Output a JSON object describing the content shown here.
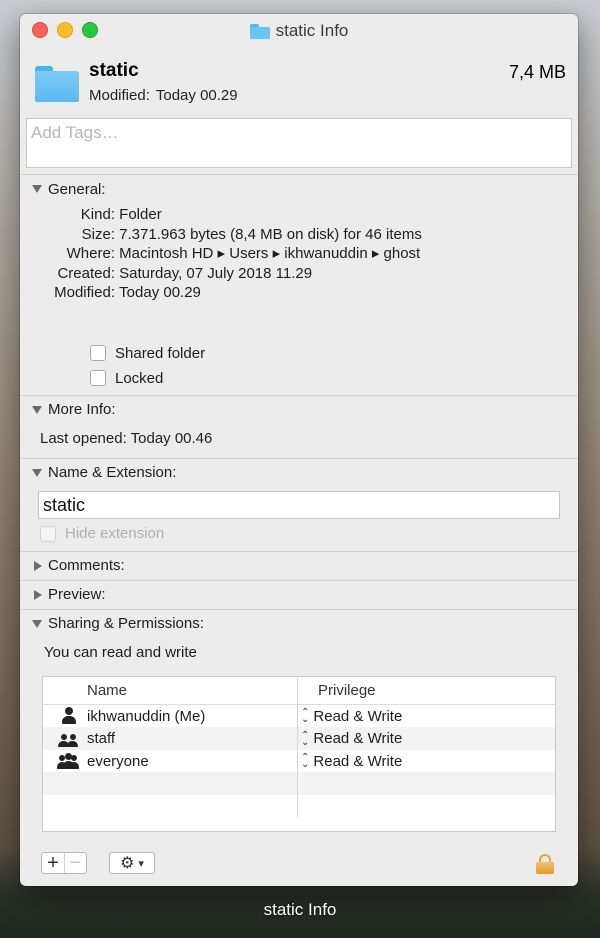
{
  "window": {
    "title": "static Info"
  },
  "header": {
    "name": "static",
    "modified_label": "Modified:",
    "modified_value": "Today 00.29",
    "size": "7,4 MB"
  },
  "tags": {
    "placeholder": "Add Tags…"
  },
  "general": {
    "heading": "General:",
    "rows": [
      {
        "k": "Kind:",
        "v": "Folder"
      },
      {
        "k": "Size:",
        "v": "7.371.963 bytes (8,4 MB on disk) for 46 items"
      },
      {
        "k": "Where:",
        "v": "Macintosh HD ▸ Users ▸ ikhwanuddin ▸ ghost"
      },
      {
        "k": "Created:",
        "v": "Saturday, 07 July 2018 11.29"
      },
      {
        "k": "Modified:",
        "v": "Today 00.29"
      }
    ],
    "shared_folder": "Shared folder",
    "locked": "Locked"
  },
  "more_info": {
    "heading": "More Info:",
    "last_opened": "Last opened: Today 00.46"
  },
  "name_ext": {
    "heading": "Name & Extension:",
    "name_value": "static",
    "hide_extension": "Hide extension"
  },
  "comments": {
    "heading": "Comments:"
  },
  "preview": {
    "heading": "Preview:"
  },
  "sharing": {
    "heading": "Sharing & Permissions:",
    "note": "You can read and write",
    "col_name": "Name",
    "col_privilege": "Privilege",
    "rows": [
      {
        "name": "ikhwanuddin (Me)",
        "privilege": "Read & Write"
      },
      {
        "name": "staff",
        "privilege": "Read & Write"
      },
      {
        "name": "everyone",
        "privilege": "Read & Write"
      }
    ]
  },
  "toolbar": {
    "plus": "+",
    "minus": "−",
    "gear": "⚙"
  },
  "dock": {
    "label": "static Info"
  }
}
